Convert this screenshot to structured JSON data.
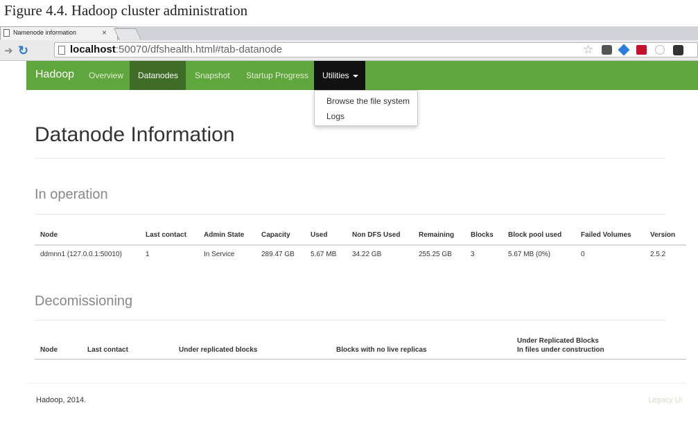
{
  "caption": "Figure 4.4. Hadoop cluster administration",
  "browser": {
    "tab_title": "Namenode information",
    "tab_close": "×",
    "url_host": "localhost",
    "url_rest": ":50070/dfshealth.html#tab-datanode"
  },
  "navbar": {
    "brand": "Hadoop",
    "items": [
      "Overview",
      "Datanodes",
      "Snapshot",
      "Startup Progress",
      "Utilities"
    ],
    "active": "Datanodes",
    "dropdown": [
      "Browse the file system",
      "Logs"
    ]
  },
  "page_title": "Datanode Information",
  "in_operation": {
    "title": "In operation",
    "headers": [
      "Node",
      "Last contact",
      "Admin State",
      "Capacity",
      "Used",
      "Non DFS Used",
      "Remaining",
      "Blocks",
      "Block pool used",
      "Failed Volumes",
      "Version"
    ],
    "rows": [
      [
        "ddmnn1 (127.0.0.1:50010)",
        "1",
        "In Service",
        "289.47 GB",
        "5.67 MB",
        "34.22 GB",
        "255.25 GB",
        "3",
        "5.67 MB (0%)",
        "0",
        "2.5.2"
      ]
    ]
  },
  "decommissioning": {
    "title": "Decomissioning",
    "headers": [
      "Node",
      "Last contact",
      "Under replicated blocks",
      "Blocks with no live replicas",
      "Under Replicated Blocks",
      "In files under construction"
    ]
  },
  "footer": {
    "left": "Hadoop, 2014.",
    "right": "Legacy UI"
  },
  "colors": {
    "navbar": "#5fa63c",
    "navbar_active": "#3f6d27",
    "utilities_open": "#111111"
  },
  "icons": [
    "page-icon",
    "close-icon",
    "forward-icon",
    "reload-icon",
    "document-icon",
    "star-icon",
    "pocket-icon",
    "dropbox-icon",
    "extension-icon",
    "user-icon",
    "menu-icon",
    "caret-down-icon"
  ]
}
